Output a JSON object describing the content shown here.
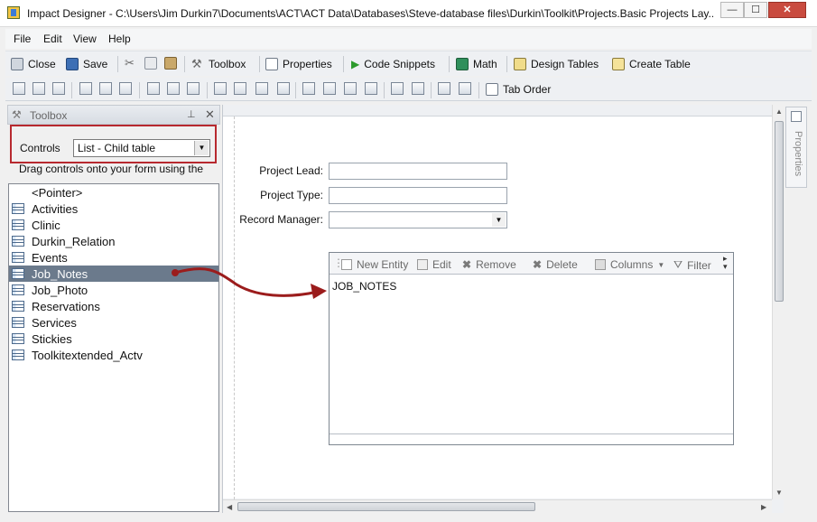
{
  "window": {
    "title": "Impact Designer - C:\\Users\\Jim Durkin7\\Documents\\ACT\\ACT Data\\Databases\\Steve-database files\\Durkin\\Toolkit\\Projects.Basic Projects Lay...",
    "min": "—",
    "max": "☐",
    "close": "✕"
  },
  "menu": [
    "File",
    "Edit",
    "View",
    "Help"
  ],
  "toolbar": {
    "close": "Close",
    "save": "Save",
    "toolbox": "Toolbox",
    "properties": "Properties",
    "code_snippets": "Code Snippets",
    "math": "Math",
    "design_tables": "Design Tables",
    "create_table": "Create Table",
    "tab_order": "Tab Order"
  },
  "toolbox": {
    "title": "Toolbox",
    "pin": "⊥",
    "close": "✕",
    "controls_label": "Controls",
    "controls_value": "List - Child table",
    "hint": "Drag controls onto your form using the",
    "items": [
      "<Pointer>",
      "Activities",
      "Clinic",
      "Durkin_Relation",
      "Events",
      "Job_Notes",
      "Job_Photo",
      "Reservations",
      "Services",
      "Stickies",
      "Toolkitextended_Actv"
    ],
    "selected_index": 5
  },
  "form": {
    "project_lead_label": "Project Lead:",
    "project_type_label": "Project Type:",
    "record_manager_label": "Record Manager:",
    "grid": {
      "new_entity": "New Entity",
      "edit": "Edit",
      "remove": "Remove",
      "delete": "Delete",
      "columns": "Columns",
      "filter": "Filter",
      "table_name": "JOB_NOTES"
    }
  },
  "properties_tab": "Properties",
  "colors": {
    "highlight": "#b7292f",
    "selected_row": "#6b7a8c",
    "arrow": "#9b1c1c"
  }
}
